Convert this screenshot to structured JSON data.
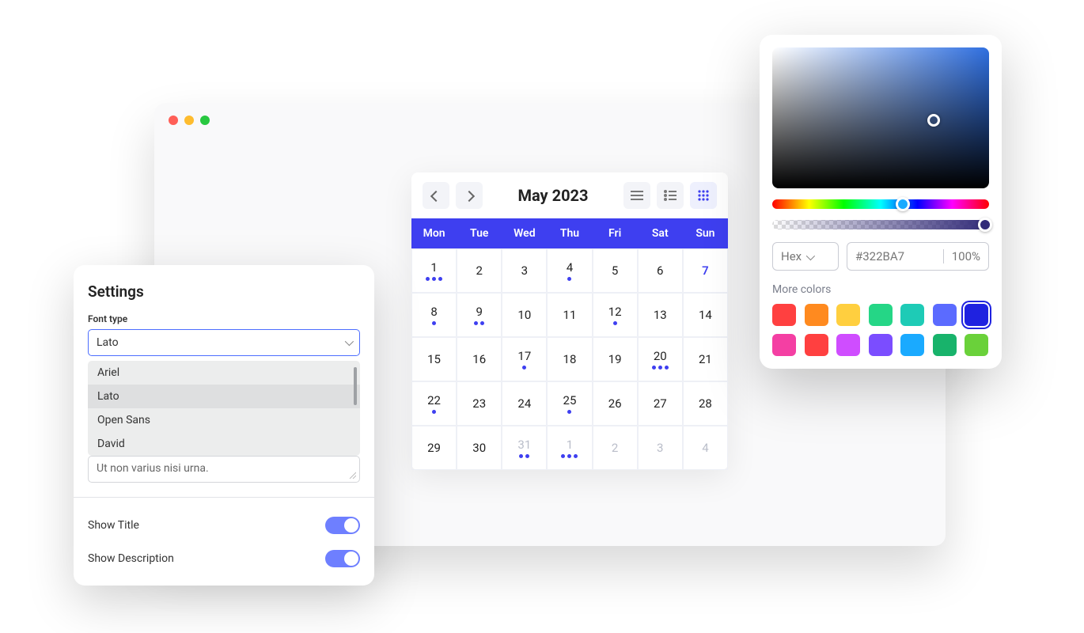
{
  "window": {
    "traffic_colors": [
      "#ff5f57",
      "#febc2e",
      "#28c840"
    ]
  },
  "calendar": {
    "title": "May 2023",
    "day_headers": [
      "Mon",
      "Tue",
      "Wed",
      "Thu",
      "Fri",
      "Sat",
      "Sun"
    ],
    "cells": [
      {
        "n": 1,
        "dots": 3
      },
      {
        "n": 2,
        "dots": 0
      },
      {
        "n": 3,
        "dots": 0
      },
      {
        "n": 4,
        "dots": 1
      },
      {
        "n": 5,
        "dots": 0
      },
      {
        "n": 6,
        "dots": 0
      },
      {
        "n": 7,
        "dots": 0,
        "highlight": true
      },
      {
        "n": 8,
        "dots": 1
      },
      {
        "n": 9,
        "dots": 2
      },
      {
        "n": 10,
        "dots": 0
      },
      {
        "n": 11,
        "dots": 0
      },
      {
        "n": 12,
        "dots": 1
      },
      {
        "n": 13,
        "dots": 0
      },
      {
        "n": 14,
        "dots": 0
      },
      {
        "n": 15,
        "dots": 0
      },
      {
        "n": 16,
        "dots": 0
      },
      {
        "n": 17,
        "dots": 1
      },
      {
        "n": 18,
        "dots": 0
      },
      {
        "n": 19,
        "dots": 0
      },
      {
        "n": 20,
        "dots": 3
      },
      {
        "n": 21,
        "dots": 0
      },
      {
        "n": 22,
        "dots": 1
      },
      {
        "n": 23,
        "dots": 0
      },
      {
        "n": 24,
        "dots": 0
      },
      {
        "n": 25,
        "dots": 1
      },
      {
        "n": 26,
        "dots": 0
      },
      {
        "n": 27,
        "dots": 0
      },
      {
        "n": 28,
        "dots": 0
      },
      {
        "n": 29,
        "dots": 0
      },
      {
        "n": 30,
        "dots": 0
      },
      {
        "n": 31,
        "dots": 2,
        "muted": true
      },
      {
        "n": 1,
        "dots": 3,
        "muted": true
      },
      {
        "n": 2,
        "dots": 0,
        "muted": true
      },
      {
        "n": 3,
        "dots": 0,
        "muted": true
      },
      {
        "n": 4,
        "dots": 0,
        "muted": true
      }
    ]
  },
  "settings": {
    "title": "Settings",
    "font_type_label": "Font type",
    "selected_font": "Lato",
    "font_options": [
      "Ariel",
      "Lato",
      "Open Sans",
      "David"
    ],
    "textarea_value": "Ut non varius nisi urna.",
    "show_title_label": "Show Title",
    "show_title": true,
    "show_description_label": "Show Description",
    "show_description": true
  },
  "colorpicker": {
    "format_label": "Hex",
    "hex_value": "#322BA7",
    "opacity": "100%",
    "more_colors_label": "More colors",
    "swatches": [
      {
        "c": "#ff4040"
      },
      {
        "c": "#ff8a1f"
      },
      {
        "c": "#ffcf3f"
      },
      {
        "c": "#25d686"
      },
      {
        "c": "#1ecbb6"
      },
      {
        "c": "#5b6bff"
      },
      {
        "c": "#1f22e0",
        "selected": true
      },
      {
        "c": "#f43fa3"
      },
      {
        "c": "#ff4040"
      },
      {
        "c": "#cf4dff"
      },
      {
        "c": "#7b4dff"
      },
      {
        "c": "#1aaaff"
      },
      {
        "c": "#18b36b"
      },
      {
        "c": "#6ad13a"
      }
    ]
  }
}
